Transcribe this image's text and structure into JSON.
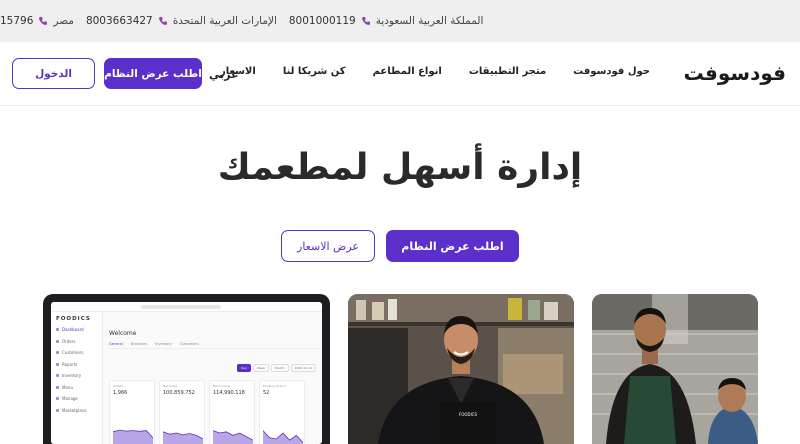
{
  "topbar": {
    "contacts": [
      {
        "country": "المملكة العربية السعودية",
        "phone": "8001000119"
      },
      {
        "country": "الإمارات العربية المتحدة",
        "phone": "8003663427"
      },
      {
        "country": "مصر",
        "phone": "15796"
      }
    ]
  },
  "nav": {
    "logo": "فودسوفت",
    "menu": [
      "حول فودسوفت",
      "متجر التطبيقات",
      "انواع المطاعم",
      "كن شريكا لنا",
      "الاسعار"
    ],
    "language": "عربي",
    "demo_button": "اطلب عرض النظام",
    "login_button": "الدخول"
  },
  "hero": {
    "title": "إدارة أسهل لمطعمك",
    "demo_button": "اطلب عرض النظام",
    "prices_button": "عرض الاسعار"
  },
  "dashboard": {
    "brand": "FOODICS",
    "sidebar": [
      "Dashboard",
      "Orders",
      "Customers",
      "Reports",
      "Inventory",
      "Menu",
      "Manage",
      "Marketplace"
    ],
    "welcome": "Welcome",
    "tabs": [
      "General",
      "Branches",
      "Inventory",
      "Customers"
    ],
    "filters": [
      "Day",
      "Week",
      "Month",
      "2020-11-14"
    ],
    "cards": [
      {
        "label": "Orders",
        "value": "1,966",
        "trend": [
          0.55,
          0.62,
          0.58,
          0.6,
          0.57,
          0.6,
          0.3
        ]
      },
      {
        "label": "Net Sales",
        "value": "100,859.752",
        "trend": [
          0.55,
          0.45,
          0.5,
          0.42,
          0.48,
          0.4,
          0.25
        ]
      },
      {
        "label": "Net Income",
        "value": "114,990.118",
        "trend": [
          0.6,
          0.5,
          0.55,
          0.4,
          0.5,
          0.35,
          0.2
        ]
      },
      {
        "label": "Existing Orders",
        "value": "52",
        "trend": [
          0.6,
          0.3,
          0.25,
          0.5,
          0.2,
          0.4,
          0.1
        ]
      }
    ]
  },
  "colors": {
    "accent": "#5b2fc9",
    "phone_icon": "#8e44ad"
  }
}
